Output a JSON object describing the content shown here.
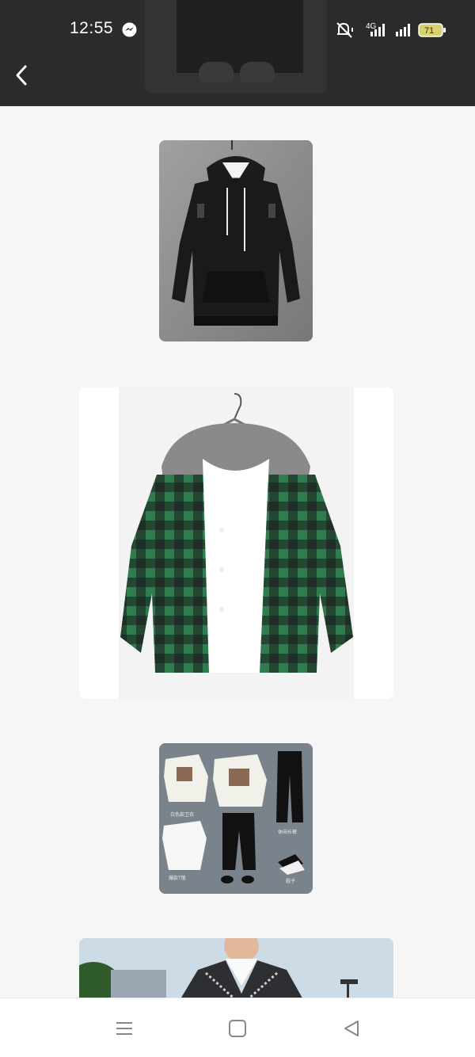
{
  "status_bar": {
    "time": "12:55",
    "network_label": "4G",
    "battery_level": "71",
    "icons": [
      "messenger-icon",
      "mute-bell-icon",
      "signal-4g-icon",
      "signal-icon",
      "battery-icon"
    ]
  },
  "header": {
    "back_icon": "chevron-left-icon"
  },
  "products": [
    {
      "name": "black-hoodie-image"
    },
    {
      "name": "green-plaid-hooded-shirt-image"
    },
    {
      "name": "outfit-set-image"
    },
    {
      "name": "knit-vest-model-image"
    }
  ],
  "outfit_captions": [
    "白色款卫衣",
    "爆款T恤",
    "休闲长裤",
    "鞋子"
  ],
  "nav": {
    "icons": [
      "menu-icon",
      "home-square-icon",
      "back-triangle-icon"
    ]
  },
  "colors": {
    "topbar": "#2b2b2b",
    "background": "#f6f6f6",
    "battery": "#d8d36a"
  }
}
